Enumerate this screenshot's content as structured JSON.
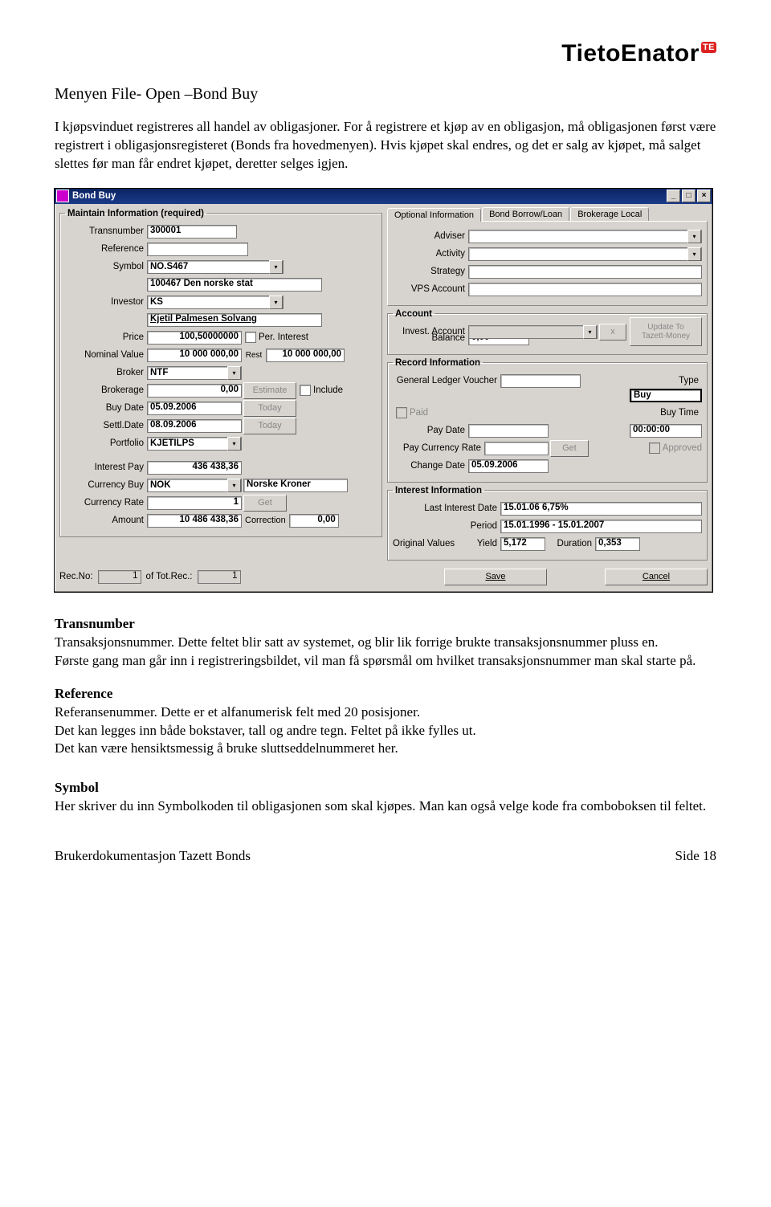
{
  "logo": {
    "text": "TietoEnator",
    "badge": "TE"
  },
  "heading": "Menyen File- Open –Bond Buy",
  "intro": "I kjøpsvinduet registreres all handel av obligasjoner. For å registrere et kjøp av en obligasjon, må obligasjonen først være registrert i obligasjonsregisteret (Bonds fra hovedmenyen). Hvis kjøpet skal endres, og det er salg av kjøpet, må salget slettes før man får endret kjøpet, deretter selges igjen.",
  "screenshot": {
    "title": "Bond Buy",
    "maintain_legend": "Maintain Information (required)",
    "labels": {
      "transnumber": "Transnumber",
      "reference": "Reference",
      "symbol": "Symbol",
      "investor": "Investor",
      "price": "Price",
      "per_interest": "Per. Interest",
      "rest": "Rest",
      "nominal": "Nominal Value",
      "broker": "Broker",
      "brokerage": "Brokerage",
      "estimate": "Estimate",
      "include": "Include",
      "buydate": "Buy Date",
      "today": "Today",
      "settldate": "Settl.Date",
      "portfolio": "Portfolio",
      "interestpay": "Interest Pay",
      "currencybuy": "Currency Buy",
      "currencyrate": "Currency Rate",
      "get": "Get",
      "amount": "Amount",
      "correction": "Correction",
      "adviser": "Adviser",
      "activity": "Activity",
      "strategy": "Strategy",
      "vps": "VPS Account",
      "account_legend": "Account",
      "invest_account": "Invest. Account",
      "update_to": "Update To Tazett-Money",
      "balance": "Balance",
      "record_legend": "Record Information",
      "glv": "General Ledger Voucher",
      "type_lbl": "Type",
      "type_val": "Buy",
      "paid": "Paid",
      "paydate": "Pay Date",
      "buytime": "Buy Time",
      "paycurr": "Pay Currency Rate",
      "approved": "Approved",
      "changedate": "Change Date",
      "interest_legend": "Interest Information",
      "lastint": "Last Interest Date",
      "period": "Period",
      "origvals": "Original Values",
      "yield": "Yield",
      "duration": "Duration",
      "recno": "Rec.No:",
      "oftot": "of Tot.Rec.:",
      "save": "Save",
      "cancel": "Cancel"
    },
    "tabs": {
      "optional": "Optional Information",
      "borrow": "Bond Borrow/Loan",
      "brokerage": "Brokerage Local"
    },
    "values": {
      "transnumber": "300001",
      "reference": "",
      "symbol": "NO.S467",
      "symbol_name": "100467 Den norske stat",
      "investor": "KS",
      "investor_name": "Kjetil Palmesen Solvang",
      "price": "100,50000000",
      "rest": "10 000 000,00",
      "nominal": "10 000 000,00",
      "broker": "NTF",
      "brokerage": "0,00",
      "buydate": "05.09.2006",
      "settldate": "08.09.2006",
      "portfolio": "KJETILPS",
      "interestpay": "436 438,36",
      "currencybuy_code": "NOK",
      "currencybuy_name": "Norske Kroner",
      "currencyrate": "1",
      "amount": "10 486 438,36",
      "correction": "0,00",
      "balance": "0,00",
      "type": "Buy",
      "buytime": "00:00:00",
      "changedate": "05.09.2006",
      "lastint": "15.01.06   6,75%",
      "period": "15.01.1996 - 15.01.2007",
      "yield": "5,172",
      "duration": "0,353",
      "recno": "1",
      "totrec": "1"
    }
  },
  "desc": {
    "transnumber_h": "Transnumber",
    "transnumber_b": "Transaksjonsnummer. Dette feltet blir satt av systemet, og blir lik forrige brukte transaksjonsnummer pluss en.\nFørste gang man går inn i registreringsbildet, vil man få spørsmål om hvilket transaksjonsnummer man skal starte på.",
    "reference_h": "Reference",
    "reference_b": "Referansenummer.  Dette er et alfanumerisk felt med 20 posisjoner.\nDet kan legges inn både bokstaver, tall og andre tegn.  Feltet på ikke fylles ut.\nDet kan være hensiktsmessig å bruke sluttseddelnummeret her.",
    "symbol_h": "Symbol",
    "symbol_b": "Her skriver du inn Symbolkoden til obligasjonen som skal kjøpes. Man kan også velge kode fra comboboksen til feltet."
  },
  "footer": {
    "left": "Brukerdokumentasjon Tazett Bonds",
    "right": "Side 18"
  }
}
